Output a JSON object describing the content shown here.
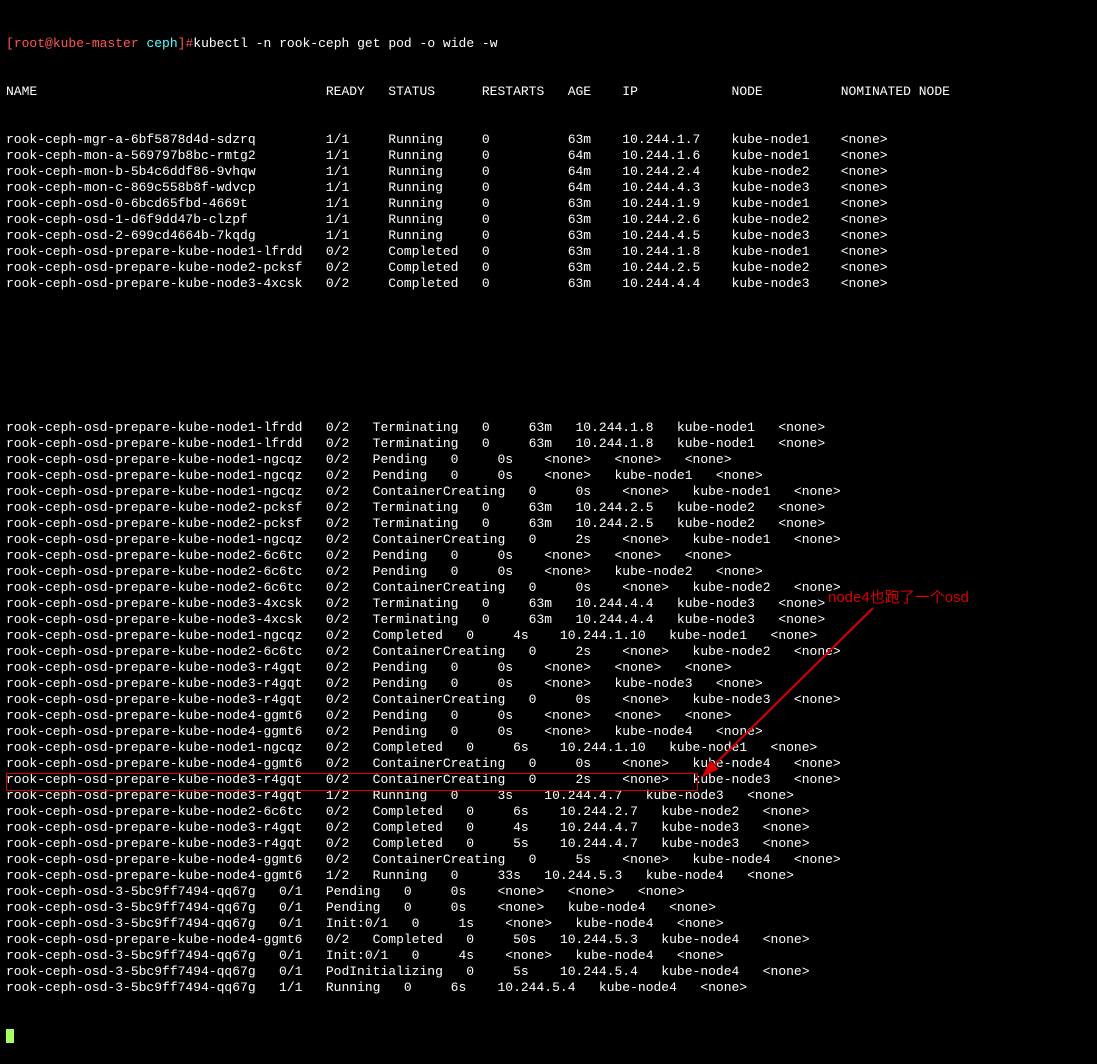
{
  "prompt": {
    "user": "root@kube-master",
    "cwd": "ceph",
    "command": "kubectl -n rook-ceph get pod -o wide -w"
  },
  "annotation": "node4也跑了一个osd",
  "headers": [
    "NAME",
    "READY",
    "STATUS",
    "RESTARTS",
    "AGE",
    "IP",
    "NODE",
    "NOMINATED NODE"
  ],
  "rows1": [
    [
      "rook-ceph-mgr-a-6bf5878d4d-sdzrq",
      "1/1",
      "Running",
      "0",
      "63m",
      "10.244.1.7",
      "kube-node1",
      "<none>"
    ],
    [
      "rook-ceph-mon-a-569797b8bc-rmtg2",
      "1/1",
      "Running",
      "0",
      "64m",
      "10.244.1.6",
      "kube-node1",
      "<none>"
    ],
    [
      "rook-ceph-mon-b-5b4c6ddf86-9vhqw",
      "1/1",
      "Running",
      "0",
      "64m",
      "10.244.2.4",
      "kube-node2",
      "<none>"
    ],
    [
      "rook-ceph-mon-c-869c558b8f-wdvcp",
      "1/1",
      "Running",
      "0",
      "64m",
      "10.244.4.3",
      "kube-node3",
      "<none>"
    ],
    [
      "rook-ceph-osd-0-6bcd65fbd-4669t",
      "1/1",
      "Running",
      "0",
      "63m",
      "10.244.1.9",
      "kube-node1",
      "<none>"
    ],
    [
      "rook-ceph-osd-1-d6f9dd47b-clzpf",
      "1/1",
      "Running",
      "0",
      "63m",
      "10.244.2.6",
      "kube-node2",
      "<none>"
    ],
    [
      "rook-ceph-osd-2-699cd4664b-7kqdg",
      "1/1",
      "Running",
      "0",
      "63m",
      "10.244.4.5",
      "kube-node3",
      "<none>"
    ],
    [
      "rook-ceph-osd-prepare-kube-node1-lfrdd",
      "0/2",
      "Completed",
      "0",
      "63m",
      "10.244.1.8",
      "kube-node1",
      "<none>"
    ],
    [
      "rook-ceph-osd-prepare-kube-node2-pcksf",
      "0/2",
      "Completed",
      "0",
      "63m",
      "10.244.2.5",
      "kube-node2",
      "<none>"
    ],
    [
      "rook-ceph-osd-prepare-kube-node3-4xcsk",
      "0/2",
      "Completed",
      "0",
      "63m",
      "10.244.4.4",
      "kube-node3",
      "<none>"
    ]
  ],
  "rows2": [
    "rook-ceph-osd-prepare-kube-node1-lfrdd   0/2   Terminating   0     63m   10.244.1.8   kube-node1   <none>",
    "rook-ceph-osd-prepare-kube-node1-lfrdd   0/2   Terminating   0     63m   10.244.1.8   kube-node1   <none>",
    "rook-ceph-osd-prepare-kube-node1-ngcqz   0/2   Pending   0     0s    <none>   <none>   <none>",
    "rook-ceph-osd-prepare-kube-node1-ngcqz   0/2   Pending   0     0s    <none>   kube-node1   <none>",
    "rook-ceph-osd-prepare-kube-node1-ngcqz   0/2   ContainerCreating   0     0s    <none>   kube-node1   <none>",
    "rook-ceph-osd-prepare-kube-node2-pcksf   0/2   Terminating   0     63m   10.244.2.5   kube-node2   <none>",
    "rook-ceph-osd-prepare-kube-node2-pcksf   0/2   Terminating   0     63m   10.244.2.5   kube-node2   <none>",
    "rook-ceph-osd-prepare-kube-node1-ngcqz   0/2   ContainerCreating   0     2s    <none>   kube-node1   <none>",
    "rook-ceph-osd-prepare-kube-node2-6c6tc   0/2   Pending   0     0s    <none>   <none>   <none>",
    "rook-ceph-osd-prepare-kube-node2-6c6tc   0/2   Pending   0     0s    <none>   kube-node2   <none>",
    "rook-ceph-osd-prepare-kube-node2-6c6tc   0/2   ContainerCreating   0     0s    <none>   kube-node2   <none>",
    "rook-ceph-osd-prepare-kube-node3-4xcsk   0/2   Terminating   0     63m   10.244.4.4   kube-node3   <none>",
    "rook-ceph-osd-prepare-kube-node3-4xcsk   0/2   Terminating   0     63m   10.244.4.4   kube-node3   <none>",
    "rook-ceph-osd-prepare-kube-node1-ngcqz   0/2   Completed   0     4s    10.244.1.10   kube-node1   <none>",
    "rook-ceph-osd-prepare-kube-node2-6c6tc   0/2   ContainerCreating   0     2s    <none>   kube-node2   <none>",
    "rook-ceph-osd-prepare-kube-node3-r4gqt   0/2   Pending   0     0s    <none>   <none>   <none>",
    "rook-ceph-osd-prepare-kube-node3-r4gqt   0/2   Pending   0     0s    <none>   kube-node3   <none>",
    "rook-ceph-osd-prepare-kube-node3-r4gqt   0/2   ContainerCreating   0     0s    <none>   kube-node3   <none>",
    "rook-ceph-osd-prepare-kube-node4-ggmt6   0/2   Pending   0     0s    <none>   <none>   <none>",
    "rook-ceph-osd-prepare-kube-node4-ggmt6   0/2   Pending   0     0s    <none>   kube-node4   <none>",
    "rook-ceph-osd-prepare-kube-node1-ngcqz   0/2   Completed   0     6s    10.244.1.10   kube-node1   <none>",
    "rook-ceph-osd-prepare-kube-node4-ggmt6   0/2   ContainerCreating   0     0s    <none>   kube-node4   <none>",
    "rook-ceph-osd-prepare-kube-node3-r4gqt   0/2   ContainerCreating   0     2s    <none>   kube-node3   <none>",
    "rook-ceph-osd-prepare-kube-node3-r4gqt   1/2   Running   0     3s    10.244.4.7   kube-node3   <none>",
    "rook-ceph-osd-prepare-kube-node2-6c6tc   0/2   Completed   0     6s    10.244.2.7   kube-node2   <none>",
    "rook-ceph-osd-prepare-kube-node3-r4gqt   0/2   Completed   0     4s    10.244.4.7   kube-node3   <none>",
    "rook-ceph-osd-prepare-kube-node3-r4gqt   0/2   Completed   0     5s    10.244.4.7   kube-node3   <none>",
    "rook-ceph-osd-prepare-kube-node4-ggmt6   0/2   ContainerCreating   0     5s    <none>   kube-node4   <none>",
    "rook-ceph-osd-prepare-kube-node4-ggmt6   1/2   Running   0     33s   10.244.5.3   kube-node4   <none>",
    "rook-ceph-osd-3-5bc9ff7494-qq67g   0/1   Pending   0     0s    <none>   <none>   <none>",
    "rook-ceph-osd-3-5bc9ff7494-qq67g   0/1   Pending   0     0s    <none>   kube-node4   <none>",
    "rook-ceph-osd-3-5bc9ff7494-qq67g   0/1   Init:0/1   0     1s    <none>   kube-node4   <none>",
    "rook-ceph-osd-prepare-kube-node4-ggmt6   0/2   Completed   0     50s   10.244.5.3   kube-node4   <none>",
    "rook-ceph-osd-3-5bc9ff7494-qq67g   0/1   Init:0/1   0     4s    <none>   kube-node4   <none>",
    "rook-ceph-osd-3-5bc9ff7494-qq67g   0/1   PodInitializing   0     5s    10.244.5.4   kube-node4   <none>",
    "rook-ceph-osd-3-5bc9ff7494-qq67g   1/1   Running   0     6s    10.244.5.4   kube-node4   <none>"
  ]
}
